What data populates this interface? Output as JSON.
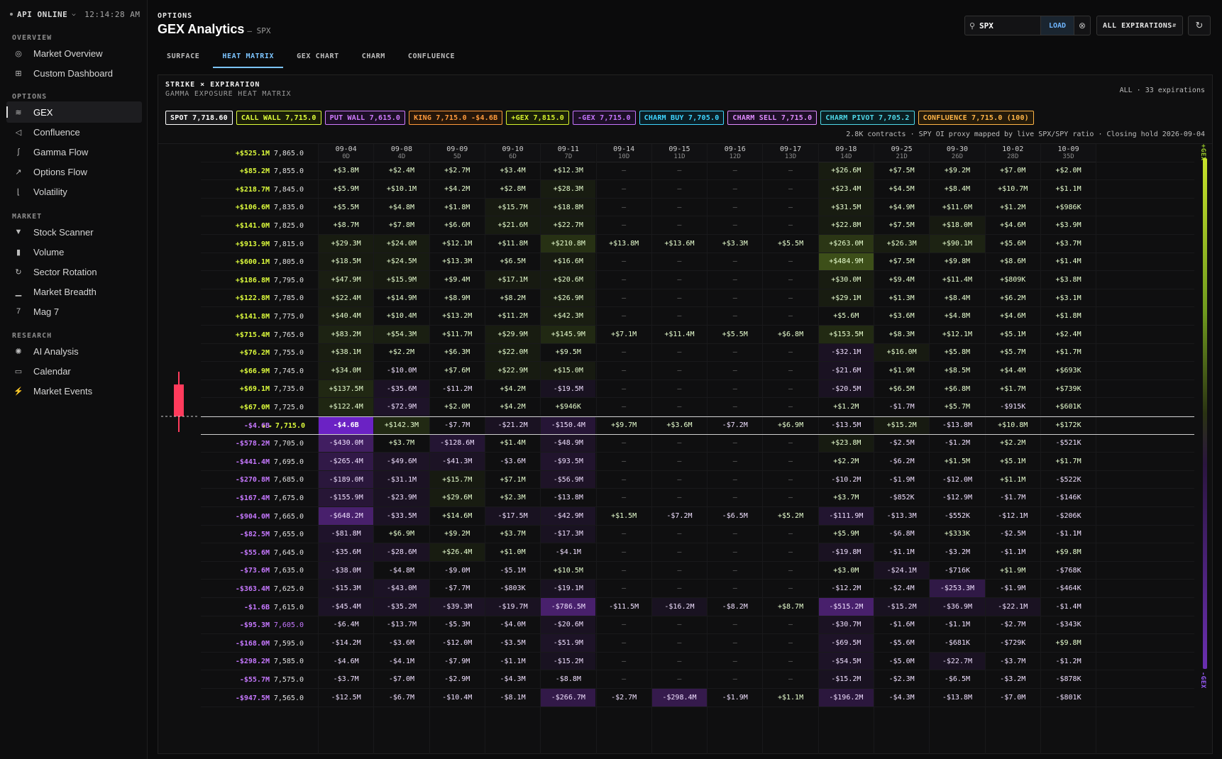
{
  "api": {
    "status": "API ONLINE",
    "clock": "12:14:28 AM"
  },
  "sidebar": {
    "sections": [
      {
        "label": "OVERVIEW",
        "items": [
          {
            "label": "Market Overview",
            "icon": "compass-icon"
          },
          {
            "label": "Custom Dashboard",
            "icon": "grid-icon"
          }
        ]
      },
      {
        "label": "OPTIONS",
        "items": [
          {
            "label": "GEX",
            "icon": "layers-icon",
            "active": true
          },
          {
            "label": "Confluence",
            "icon": "send-icon"
          },
          {
            "label": "Gamma Flow",
            "icon": "pulse-icon"
          },
          {
            "label": "Options Flow",
            "icon": "trend-icon"
          },
          {
            "label": "Volatility",
            "icon": "chart-icon"
          }
        ]
      },
      {
        "label": "MARKET",
        "items": [
          {
            "label": "Stock Scanner",
            "icon": "filter-icon"
          },
          {
            "label": "Volume",
            "icon": "bars-icon"
          },
          {
            "label": "Sector Rotation",
            "icon": "rotate-icon"
          },
          {
            "label": "Market Breadth",
            "icon": "signal-icon"
          },
          {
            "label": "Mag 7",
            "icon": "seven-icon"
          }
        ]
      },
      {
        "label": "RESEARCH",
        "items": [
          {
            "label": "AI Analysis",
            "icon": "sparkle-icon"
          },
          {
            "label": "Calendar",
            "icon": "calendar-icon"
          },
          {
            "label": "Market Events",
            "icon": "bolt-icon"
          }
        ]
      }
    ]
  },
  "header": {
    "crumb": "OPTIONS",
    "title": "GEX Analytics",
    "subtitle": "— SPX"
  },
  "tabs": [
    {
      "label": "SURFACE"
    },
    {
      "label": "HEAT MATRIX",
      "active": true
    },
    {
      "label": "GEX CHART"
    },
    {
      "label": "CHARM"
    },
    {
      "label": "CONFLUENCE"
    }
  ],
  "search": {
    "value": "SPX",
    "load_label": "LOAD"
  },
  "expiration_select": {
    "value": "ALL EXPIRATIONS"
  },
  "panel": {
    "title": "STRIKE × EXPIRATION",
    "subtitle": "GAMMA EXPOSURE HEAT MATRIX",
    "exp_count": "ALL · 33 expirations",
    "meta": "2.8K contracts · SPY OI proxy mapped by live SPX/SPY ratio · Closing hold 2026-09-04",
    "chips": [
      {
        "label": "SPOT 7,718.60",
        "color": "#ffffff",
        "bg": "#1a1a1c"
      },
      {
        "label": "CALL WALL 7,715.0",
        "color": "#e0ff3a",
        "bg": "#1a1d08"
      },
      {
        "label": "PUT WALL 7,615.0",
        "color": "#d07bff",
        "bg": "#1c0f26"
      },
      {
        "label": "KING 7,715.0 -$4.6B",
        "color": "#ff9a3c",
        "bg": "#25160a"
      },
      {
        "label": "+GEX 7,815.0",
        "color": "#d6f22c",
        "bg": "#1a1f08"
      },
      {
        "label": "-GEX 7,715.0",
        "color": "#c675ff",
        "bg": "#1c0f26"
      },
      {
        "label": "CHARM BUY 7,705.0",
        "color": "#3fd5ff",
        "bg": "#0a1d24"
      },
      {
        "label": "CHARM SELL 7,715.0",
        "color": "#e08bff",
        "bg": "#1d0f26"
      },
      {
        "label": "CHARM PIVOT 7,705.2",
        "color": "#4fd8e8",
        "bg": "#0a1e22"
      },
      {
        "label": "CONFLUENCE 7,715.0 (100)",
        "color": "#ffb547",
        "bg": "#241a0a"
      }
    ]
  },
  "candle": {
    "spot_row": 15
  },
  "matrix": {
    "expirations": [
      {
        "date": "09-04",
        "dte": "0D"
      },
      {
        "date": "09-08",
        "dte": "4D"
      },
      {
        "date": "09-09",
        "dte": "5D"
      },
      {
        "date": "09-10",
        "dte": "6D"
      },
      {
        "date": "09-11",
        "dte": "7D"
      },
      {
        "date": "09-14",
        "dte": "10D"
      },
      {
        "date": "09-15",
        "dte": "11D"
      },
      {
        "date": "09-16",
        "dte": "12D"
      },
      {
        "date": "09-17",
        "dte": "13D"
      },
      {
        "date": "09-18",
        "dte": "14D"
      },
      {
        "date": "09-25",
        "dte": "21D"
      },
      {
        "date": "09-30",
        "dte": "26D"
      },
      {
        "date": "10-02",
        "dte": "28D"
      },
      {
        "date": "10-09",
        "dte": "35D"
      }
    ],
    "rows": [
      {
        "total": "+$525.1M",
        "strike": "7,865.0",
        "cells": []
      },
      {
        "total": "+$85.2M",
        "strike": "7,855.0",
        "cells": [
          "+$3.8M",
          "+$2.4M",
          "+$2.7M",
          "+$3.4M",
          "+$12.3M",
          "—",
          "—",
          "—",
          "—",
          "+$26.6M",
          "+$7.5M",
          "+$9.2M",
          "+$7.0M",
          "+$2.0M"
        ]
      },
      {
        "total": "+$218.7M",
        "strike": "7,845.0",
        "cells": [
          "+$5.9M",
          "+$10.1M",
          "+$4.2M",
          "+$2.8M",
          "+$28.3M",
          "—",
          "—",
          "—",
          "—",
          "+$23.4M",
          "+$4.5M",
          "+$8.4M",
          "+$10.7M",
          "+$1.1M"
        ]
      },
      {
        "total": "+$106.6M",
        "strike": "7,835.0",
        "cells": [
          "+$5.5M",
          "+$4.8M",
          "+$1.8M",
          "+$15.7M",
          "+$18.8M",
          "—",
          "—",
          "—",
          "—",
          "+$31.5M",
          "+$4.9M",
          "+$11.6M",
          "+$1.2M",
          "+$986K"
        ]
      },
      {
        "total": "+$141.0M",
        "strike": "7,825.0",
        "cells": [
          "+$8.7M",
          "+$7.8M",
          "+$6.6M",
          "+$21.6M",
          "+$22.7M",
          "—",
          "—",
          "—",
          "—",
          "+$22.8M",
          "+$7.5M",
          "+$18.0M",
          "+$4.6M",
          "+$3.9M"
        ]
      },
      {
        "total": "+$913.9M",
        "strike": "7,815.0",
        "cells": [
          "+$29.3M",
          "+$24.0M",
          "+$12.1M",
          "+$11.8M",
          "+$210.8M",
          "+$13.8M",
          "+$13.6M",
          "+$3.3M",
          "+$5.5M",
          "+$263.0M",
          "+$26.3M",
          "+$90.1M",
          "+$5.6M",
          "+$3.7M"
        ]
      },
      {
        "total": "+$600.1M",
        "strike": "7,805.0",
        "cells": [
          "+$18.5M",
          "+$24.5M",
          "+$13.3M",
          "+$6.5M",
          "+$16.6M",
          "—",
          "—",
          "—",
          "—",
          "+$484.9M",
          "+$7.5M",
          "+$9.8M",
          "+$8.6M",
          "+$1.4M"
        ]
      },
      {
        "total": "+$186.8M",
        "strike": "7,795.0",
        "cells": [
          "+$47.9M",
          "+$15.9M",
          "+$9.4M",
          "+$17.1M",
          "+$20.6M",
          "—",
          "—",
          "—",
          "—",
          "+$30.0M",
          "+$9.4M",
          "+$11.4M",
          "+$809K",
          "+$3.8M"
        ]
      },
      {
        "total": "+$122.8M",
        "strike": "7,785.0",
        "cells": [
          "+$22.4M",
          "+$14.9M",
          "+$8.9M",
          "+$8.2M",
          "+$26.9M",
          "—",
          "—",
          "—",
          "—",
          "+$29.1M",
          "+$1.3M",
          "+$8.4M",
          "+$6.2M",
          "+$3.1M"
        ]
      },
      {
        "total": "+$141.8M",
        "strike": "7,775.0",
        "cells": [
          "+$40.4M",
          "+$10.4M",
          "+$13.2M",
          "+$11.2M",
          "+$42.3M",
          "—",
          "—",
          "—",
          "—",
          "+$5.6M",
          "+$3.6M",
          "+$4.8M",
          "+$4.6M",
          "+$1.8M"
        ]
      },
      {
        "total": "+$715.4M",
        "strike": "7,765.0",
        "cells": [
          "+$83.2M",
          "+$54.3M",
          "+$11.7M",
          "+$29.9M",
          "+$145.9M",
          "+$7.1M",
          "+$11.4M",
          "+$5.5M",
          "+$6.8M",
          "+$153.5M",
          "+$8.3M",
          "+$12.1M",
          "+$5.1M",
          "+$2.4M"
        ]
      },
      {
        "total": "+$76.2M",
        "strike": "7,755.0",
        "cells": [
          "+$38.1M",
          "+$2.2M",
          "+$6.3M",
          "+$22.0M",
          "+$9.5M",
          "—",
          "—",
          "—",
          "—",
          "-$32.1M",
          "+$16.0M",
          "+$5.8M",
          "+$5.7M",
          "+$1.7M"
        ]
      },
      {
        "total": "+$66.9M",
        "strike": "7,745.0",
        "cells": [
          "+$34.0M",
          "-$10.0M",
          "+$7.6M",
          "+$22.9M",
          "+$15.0M",
          "—",
          "—",
          "—",
          "—",
          "-$21.6M",
          "+$1.9M",
          "+$8.5M",
          "+$4.4M",
          "+$693K"
        ]
      },
      {
        "total": "+$69.1M",
        "strike": "7,735.0",
        "cells": [
          "+$137.5M",
          "-$35.6M",
          "-$11.2M",
          "+$4.2M",
          "-$19.5M",
          "—",
          "—",
          "—",
          "—",
          "-$20.5M",
          "+$6.5M",
          "+$6.8M",
          "+$1.7M",
          "+$739K"
        ]
      },
      {
        "total": "+$67.0M",
        "strike": "7,725.0",
        "cells": [
          "+$122.4M",
          "-$72.9M",
          "+$2.0M",
          "+$4.2M",
          "+$946K",
          "—",
          "—",
          "—",
          "—",
          "+$1.2M",
          "-$1.7M",
          "+$5.7M",
          "-$915K",
          "+$601K"
        ]
      },
      {
        "total": "-$4.6B",
        "strike": "7,715.0",
        "marker": "★ ▸",
        "cells": [
          "-$4.6B",
          "+$142.3M",
          "-$7.7M",
          "-$21.2M",
          "-$150.4M",
          "+$9.7M",
          "+$3.6M",
          "-$7.2M",
          "+$6.9M",
          "-$13.5M",
          "+$15.2M",
          "-$13.8M",
          "+$10.8M",
          "+$172K"
        ]
      },
      {
        "total": "-$578.2M",
        "strike": "7,705.0",
        "cells": [
          "-$430.0M",
          "+$3.7M",
          "-$128.6M",
          "+$1.4M",
          "-$48.9M",
          "—",
          "—",
          "—",
          "—",
          "+$23.8M",
          "-$2.5M",
          "-$1.2M",
          "+$2.2M",
          "-$521K"
        ]
      },
      {
        "total": "-$441.4M",
        "strike": "7,695.0",
        "cells": [
          "-$265.4M",
          "-$49.6M",
          "-$41.3M",
          "-$3.6M",
          "-$93.5M",
          "—",
          "—",
          "—",
          "—",
          "+$2.2M",
          "-$6.2M",
          "+$1.5M",
          "+$5.1M",
          "+$1.7M"
        ]
      },
      {
        "total": "-$270.8M",
        "strike": "7,685.0",
        "cells": [
          "-$189.0M",
          "-$31.1M",
          "+$15.7M",
          "+$7.1M",
          "-$56.9M",
          "—",
          "—",
          "—",
          "—",
          "-$10.2M",
          "-$1.9M",
          "-$12.0M",
          "+$1.1M",
          "-$522K"
        ]
      },
      {
        "total": "-$167.4M",
        "strike": "7,675.0",
        "cells": [
          "-$155.9M",
          "-$23.9M",
          "+$29.6M",
          "+$2.3M",
          "-$13.8M",
          "—",
          "—",
          "—",
          "—",
          "+$3.7M",
          "-$852K",
          "-$12.9M",
          "-$1.7M",
          "-$146K"
        ]
      },
      {
        "total": "-$904.0M",
        "strike": "7,665.0",
        "cells": [
          "-$648.2M",
          "-$33.5M",
          "+$14.6M",
          "-$17.5M",
          "-$42.9M",
          "+$1.5M",
          "-$7.2M",
          "-$6.5M",
          "+$5.2M",
          "-$111.9M",
          "-$13.3M",
          "-$552K",
          "-$12.1M",
          "-$206K"
        ]
      },
      {
        "total": "-$82.5M",
        "strike": "7,655.0",
        "cells": [
          "-$81.8M",
          "+$6.9M",
          "+$9.2M",
          "+$3.7M",
          "-$17.3M",
          "—",
          "—",
          "—",
          "—",
          "+$5.9M",
          "-$6.8M",
          "+$333K",
          "-$2.5M",
          "-$1.1M"
        ]
      },
      {
        "total": "-$55.6M",
        "strike": "7,645.0",
        "cells": [
          "-$35.6M",
          "-$28.6M",
          "+$26.4M",
          "+$1.0M",
          "-$4.1M",
          "—",
          "—",
          "—",
          "—",
          "-$19.8M",
          "-$1.1M",
          "-$3.2M",
          "-$1.1M",
          "+$9.8M"
        ]
      },
      {
        "total": "-$73.6M",
        "strike": "7,635.0",
        "cells": [
          "-$38.0M",
          "-$4.8M",
          "-$9.0M",
          "-$5.1M",
          "+$10.5M",
          "—",
          "—",
          "—",
          "—",
          "+$3.0M",
          "-$24.1M",
          "-$716K",
          "+$1.9M",
          "-$768K"
        ]
      },
      {
        "total": "-$363.4M",
        "strike": "7,625.0",
        "cells": [
          "-$15.3M",
          "-$43.0M",
          "-$7.7M",
          "-$803K",
          "-$19.1M",
          "—",
          "—",
          "—",
          "—",
          "-$12.2M",
          "-$2.4M",
          "-$253.3M",
          "-$1.9M",
          "-$464K"
        ]
      },
      {
        "total": "-$1.6B",
        "strike": "7,615.0",
        "cells": [
          "-$45.4M",
          "-$35.2M",
          "-$39.3M",
          "-$19.7M",
          "-$786.5M",
          "-$11.5M",
          "-$16.2M",
          "-$8.2M",
          "+$8.7M",
          "-$515.2M",
          "-$15.2M",
          "-$36.9M",
          "-$22.1M",
          "-$1.4M"
        ]
      },
      {
        "total": "-$95.3M",
        "strike": "7,605.0",
        "cells": [
          "-$6.4M",
          "-$13.7M",
          "-$5.3M",
          "-$4.0M",
          "-$20.6M",
          "—",
          "—",
          "—",
          "—",
          "-$30.7M",
          "-$1.6M",
          "-$1.1M",
          "-$2.7M",
          "-$343K"
        ]
      },
      {
        "total": "-$168.0M",
        "strike": "7,595.0",
        "cells": [
          "-$14.2M",
          "-$3.6M",
          "-$12.0M",
          "-$3.5M",
          "-$51.9M",
          "—",
          "—",
          "—",
          "—",
          "-$69.5M",
          "-$5.6M",
          "-$681K",
          "-$729K",
          "+$9.8M"
        ]
      },
      {
        "total": "-$298.2M",
        "strike": "7,585.0",
        "cells": [
          "-$4.6M",
          "-$4.1M",
          "-$7.9M",
          "-$1.1M",
          "-$15.2M",
          "—",
          "—",
          "—",
          "—",
          "-$54.5M",
          "-$5.0M",
          "-$22.7M",
          "-$3.7M",
          "-$1.2M"
        ]
      },
      {
        "total": "-$55.7M",
        "strike": "7,575.0",
        "cells": [
          "-$3.7M",
          "-$7.0M",
          "-$2.9M",
          "-$4.3M",
          "-$8.8M",
          "—",
          "—",
          "—",
          "—",
          "-$15.2M",
          "-$2.3M",
          "-$6.5M",
          "-$3.2M",
          "-$878K"
        ]
      },
      {
        "total": "-$947.5M",
        "strike": "7,565.0",
        "cells": [
          "-$12.5M",
          "-$6.7M",
          "-$10.4M",
          "-$8.1M",
          "-$266.7M",
          "-$2.7M",
          "-$298.4M",
          "-$1.9M",
          "+$1.1M",
          "-$196.2M",
          "-$4.3M",
          "-$13.8M",
          "-$7.0M",
          "-$801K"
        ]
      }
    ]
  },
  "legend": {
    "top": "+GEX",
    "bottom": "-GEX"
  }
}
